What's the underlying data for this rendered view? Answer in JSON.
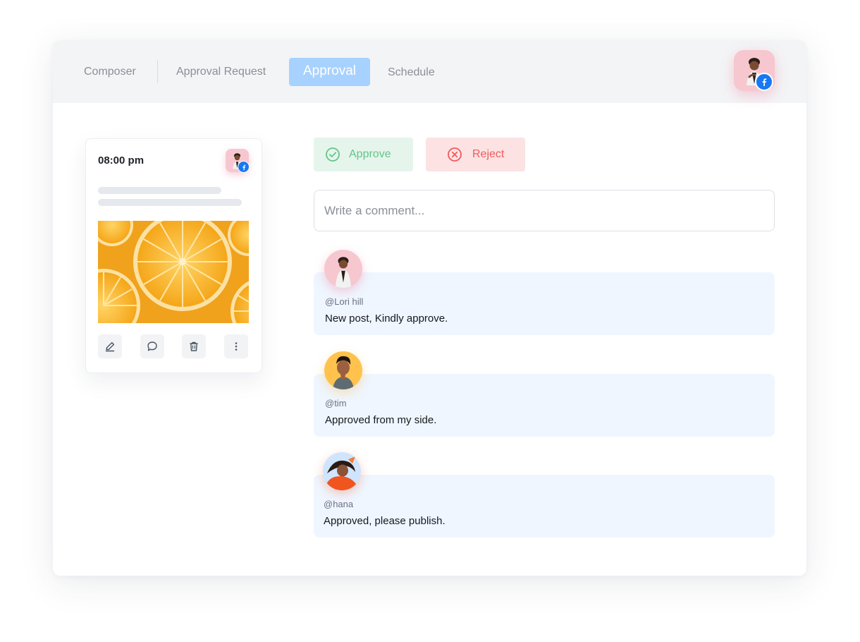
{
  "nav": {
    "tabs": [
      {
        "label": "Composer"
      },
      {
        "label": "Approval Request"
      },
      {
        "label": "Approval"
      },
      {
        "label": "Schedule"
      }
    ],
    "active_tab": "Approval"
  },
  "profile": {
    "network_icon": "facebook-icon",
    "avatar_icon": "user-avatar"
  },
  "post_card": {
    "time": "08:00 pm",
    "image_icon": "orange-slices-photo",
    "actions": [
      {
        "icon": "edit-icon"
      },
      {
        "icon": "comment-icon"
      },
      {
        "icon": "trash-icon"
      },
      {
        "icon": "more-vertical-icon"
      }
    ]
  },
  "actions": {
    "approve_label": "Approve",
    "reject_label": "Reject",
    "approve_color": "#64c48b",
    "reject_color": "#ef5b5b"
  },
  "comment_box": {
    "placeholder": "Write a comment..."
  },
  "comments": [
    {
      "handle": "@Lori hill",
      "text": "New post, Kindly approve."
    },
    {
      "handle": "@tim",
      "text": "Approved from my side."
    },
    {
      "handle": "@hana",
      "text": "Approved, please publish."
    }
  ],
  "colors": {
    "active_tab": "#a7d1ff",
    "comment_bg": "#eff6ff",
    "facebook": "#1877f2"
  }
}
